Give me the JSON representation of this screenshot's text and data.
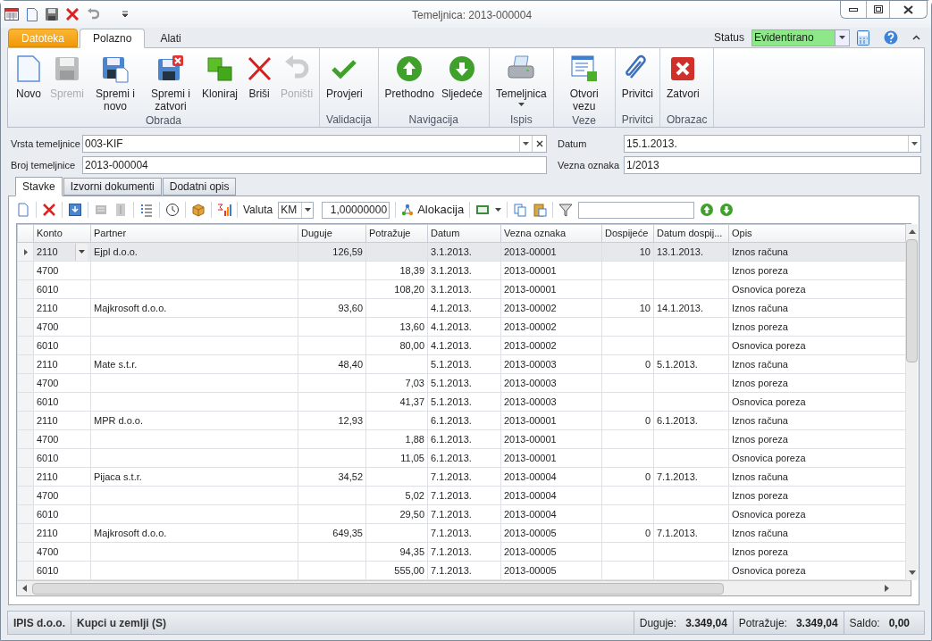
{
  "window": {
    "title": "Temeljnica: 2013-000004"
  },
  "ribbon_tabs": [
    {
      "label": "Datoteka",
      "kind": "file",
      "selected": false
    },
    {
      "label": "Polazno",
      "kind": "tab",
      "selected": true
    },
    {
      "label": "Alati",
      "kind": "tab",
      "selected": false
    }
  ],
  "status": {
    "label": "Status",
    "value": "Evidentirano"
  },
  "ribbon_groups": [
    {
      "label": "Obrada",
      "buttons": [
        {
          "label": "Novo",
          "disabled": false
        },
        {
          "label": "Spremi",
          "disabled": true
        },
        {
          "label": "Spremi i novo",
          "disabled": false
        },
        {
          "label": "Spremi i zatvori",
          "disabled": false
        },
        {
          "label": "Kloniraj",
          "disabled": false
        },
        {
          "label": "Briši",
          "disabled": false
        },
        {
          "label": "Poništi",
          "disabled": true
        }
      ]
    },
    {
      "label": "Validacija",
      "buttons": [
        {
          "label": "Provjeri",
          "disabled": false
        }
      ]
    },
    {
      "label": "Navigacija",
      "buttons": [
        {
          "label": "Prethodno",
          "disabled": false
        },
        {
          "label": "Sljedeće",
          "disabled": false
        }
      ]
    },
    {
      "label": "Ispis",
      "buttons": [
        {
          "label": "Temeljnica",
          "disabled": false,
          "dropdown": true
        }
      ]
    },
    {
      "label": "Veze",
      "buttons": [
        {
          "label": "Otvori vezu",
          "disabled": false
        }
      ]
    },
    {
      "label": "Privitci",
      "buttons": [
        {
          "label": "Privitci",
          "disabled": false
        }
      ]
    },
    {
      "label": "Obrazac",
      "buttons": [
        {
          "label": "Zatvori",
          "disabled": false
        }
      ]
    }
  ],
  "form": {
    "vrsta": {
      "label": "Vrsta temeljnice",
      "value": "003-KIF"
    },
    "datum": {
      "label": "Datum",
      "value": "15.1.2013."
    },
    "broj": {
      "label": "Broj temeljnice",
      "value": "2013-000004"
    },
    "vezna": {
      "label": "Vezna oznaka",
      "value": "1/2013"
    }
  },
  "detail_tabs": [
    {
      "label": "Stavke",
      "selected": true
    },
    {
      "label": "Izvorni dokumenti",
      "selected": false
    },
    {
      "label": "Dodatni opis",
      "selected": false
    }
  ],
  "toolbar": {
    "valuta_label": "Valuta",
    "valuta": "KM",
    "rate": "1,00000000",
    "alokacija": "Alokacija"
  },
  "table": {
    "columns": [
      "Konto",
      "Partner",
      "Duguje",
      "Potražuje",
      "Datum",
      "Vezna oznaka",
      "Dospijeće",
      "Datum dospij...",
      "Opis"
    ],
    "rows": [
      {
        "cells": [
          "2110",
          "Ejpl d.o.o.",
          "126,59",
          "",
          "3.1.2013.",
          "2013-00001",
          "10",
          "13.1.2013.",
          "Iznos računa"
        ],
        "selected": true
      },
      {
        "cells": [
          "4700",
          "",
          "",
          "18,39",
          "3.1.2013.",
          "2013-00001",
          "",
          "",
          "Iznos poreza"
        ],
        "selected": false
      },
      {
        "cells": [
          "6010",
          "",
          "",
          "108,20",
          "3.1.2013.",
          "2013-00001",
          "",
          "",
          "Osnovica poreza"
        ],
        "selected": false
      },
      {
        "cells": [
          "2110",
          "Majkrosoft d.o.o.",
          "93,60",
          "",
          "4.1.2013.",
          "2013-00002",
          "10",
          "14.1.2013.",
          "Iznos računa"
        ],
        "selected": false
      },
      {
        "cells": [
          "4700",
          "",
          "",
          "13,60",
          "4.1.2013.",
          "2013-00002",
          "",
          "",
          "Iznos poreza"
        ],
        "selected": false
      },
      {
        "cells": [
          "6010",
          "",
          "",
          "80,00",
          "4.1.2013.",
          "2013-00002",
          "",
          "",
          "Osnovica poreza"
        ],
        "selected": false
      },
      {
        "cells": [
          "2110",
          "Mate s.t.r.",
          "48,40",
          "",
          "5.1.2013.",
          "2013-00003",
          "0",
          "5.1.2013.",
          "Iznos računa"
        ],
        "selected": false
      },
      {
        "cells": [
          "4700",
          "",
          "",
          "7,03",
          "5.1.2013.",
          "2013-00003",
          "",
          "",
          "Iznos poreza"
        ],
        "selected": false
      },
      {
        "cells": [
          "6010",
          "",
          "",
          "41,37",
          "5.1.2013.",
          "2013-00003",
          "",
          "",
          "Osnovica poreza"
        ],
        "selected": false
      },
      {
        "cells": [
          "2110",
          "MPR d.o.o.",
          "12,93",
          "",
          "6.1.2013.",
          "2013-00001",
          "0",
          "6.1.2013.",
          "Iznos računa"
        ],
        "selected": false
      },
      {
        "cells": [
          "4700",
          "",
          "",
          "1,88",
          "6.1.2013.",
          "2013-00001",
          "",
          "",
          "Iznos poreza"
        ],
        "selected": false
      },
      {
        "cells": [
          "6010",
          "",
          "",
          "11,05",
          "6.1.2013.",
          "2013-00001",
          "",
          "",
          "Osnovica poreza"
        ],
        "selected": false
      },
      {
        "cells": [
          "2110",
          "Pijaca s.t.r.",
          "34,52",
          "",
          "7.1.2013.",
          "2013-00004",
          "0",
          "7.1.2013.",
          "Iznos računa"
        ],
        "selected": false
      },
      {
        "cells": [
          "4700",
          "",
          "",
          "5,02",
          "7.1.2013.",
          "2013-00004",
          "",
          "",
          "Iznos poreza"
        ],
        "selected": false
      },
      {
        "cells": [
          "6010",
          "",
          "",
          "29,50",
          "7.1.2013.",
          "2013-00004",
          "",
          "",
          "Osnovica poreza"
        ],
        "selected": false
      },
      {
        "cells": [
          "2110",
          "Majkrosoft d.o.o.",
          "649,35",
          "",
          "7.1.2013.",
          "2013-00005",
          "0",
          "7.1.2013.",
          "Iznos računa"
        ],
        "selected": false
      },
      {
        "cells": [
          "4700",
          "",
          "",
          "94,35",
          "7.1.2013.",
          "2013-00005",
          "",
          "",
          "Iznos poreza"
        ],
        "selected": false
      },
      {
        "cells": [
          "6010",
          "",
          "",
          "555,00",
          "7.1.2013.",
          "2013-00005",
          "",
          "",
          "Osnovica poreza"
        ],
        "selected": false
      }
    ]
  },
  "status_bar": {
    "company": "IPIS d.o.o.",
    "account": "Kupci u zemlji (S)",
    "duguje_label": "Duguje:",
    "duguje": "3.349,04",
    "potrazuje_label": "Potražuje:",
    "potrazuje": "3.349,04",
    "saldo_label": "Saldo:",
    "saldo": "0,00"
  }
}
